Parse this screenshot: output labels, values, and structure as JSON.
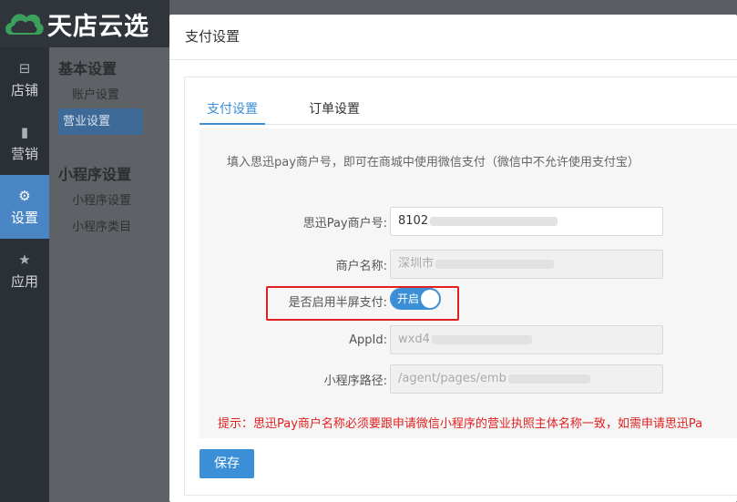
{
  "brand": {
    "logo_text": "天店云选",
    "logo_icon": "cloud-logo-icon"
  },
  "nav": {
    "items": [
      {
        "label": "店铺",
        "icon": "store-icon",
        "glyph": "⊟",
        "active": false
      },
      {
        "label": "营销",
        "icon": "bar-chart-icon",
        "glyph": "▮",
        "active": false
      },
      {
        "label": "设置",
        "icon": "gear-icon",
        "glyph": "⚙",
        "active": true
      },
      {
        "label": "应用",
        "icon": "star-icon",
        "glyph": "★",
        "active": false
      }
    ]
  },
  "subnav": {
    "group1_title": "基本设置",
    "group1_items": [
      "账户设置",
      "营业设置"
    ],
    "group2_title": "小程序设置",
    "group2_items": [
      "小程序设置",
      "小程序类目"
    ]
  },
  "modal": {
    "title": "支付设置",
    "tabs": [
      "支付设置",
      "订单设置"
    ],
    "intro": "填入思迅pay商户号，即可在商城中使用微信支付（微信中不允许使用支付宝）",
    "fields": {
      "merchant_no_label": "思迅Pay商户号:",
      "merchant_no_value": "8102",
      "merchant_name_label": "商户名称:",
      "merchant_name_value": "深圳市",
      "half_screen_label": "是否启用半屏支付:",
      "half_screen_toggle": "开启",
      "appid_label": "AppId:",
      "appid_value": "wxd4",
      "path_label": "小程序路径:",
      "path_value": "/agent/pages/emb"
    },
    "tip": "提示：思迅Pay商户名称必须要跟申请微信小程序的营业执照主体名称一致，如需申请思迅Pa",
    "save_label": "保存"
  },
  "colors": {
    "accent": "#3b8fd6",
    "highlight": "#e02020",
    "nav_active": "#4a86c5"
  }
}
